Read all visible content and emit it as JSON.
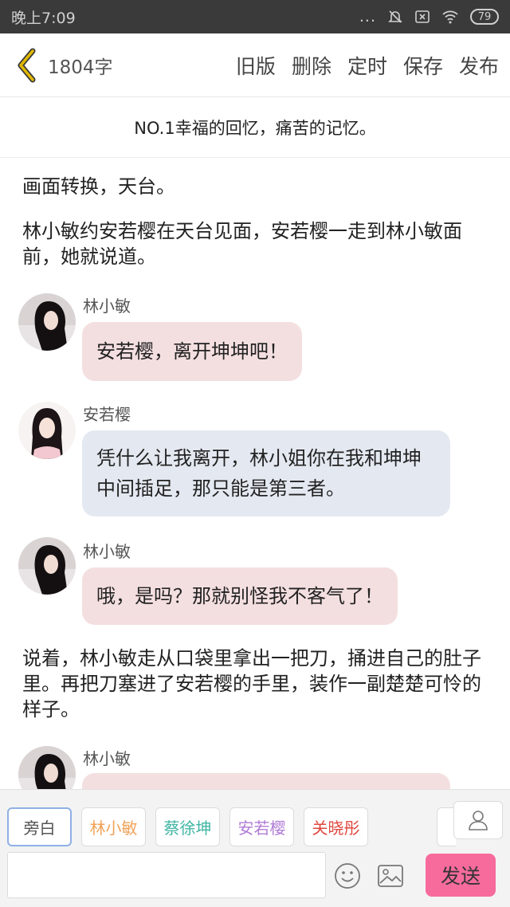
{
  "status": {
    "time": "晚上7:09",
    "dots": "...",
    "battery": "79"
  },
  "header": {
    "word_count": "1804字",
    "actions": [
      "旧版",
      "删除",
      "定时",
      "保存",
      "发布"
    ]
  },
  "chapter": {
    "title": "NO.1幸福的回忆，痛苦的记忆。"
  },
  "story": {
    "narration": [
      "画面转换，天台。",
      "林小敏约安若樱在天台见面，安若樱一走到林小敏面前，她就说道。",
      "说着，林小敏走从口袋里拿出一把刀，捅进自己的肚子里。再把刀塞进了安若樱的手里，装作一副楚楚可怜的样子。"
    ],
    "messages": [
      {
        "speaker": "林小敏",
        "text": "安若樱，离开坤坤吧！"
      },
      {
        "speaker": "安若樱",
        "text": "凭什么让我离开，林小姐你在我和坤坤中间插足，那只能是第三者。"
      },
      {
        "speaker": "林小敏",
        "text": "哦，是吗？那就别怪我不客气了！"
      },
      {
        "speaker": "林小敏",
        "text": ""
      }
    ]
  },
  "roles": [
    {
      "label": "旁白",
      "color": "#555555"
    },
    {
      "label": "林小敏",
      "color": "#f0a35a"
    },
    {
      "label": "蔡徐坤",
      "color": "#3fb5a3"
    },
    {
      "label": "安若樱",
      "color": "#b07bd6"
    },
    {
      "label": "关晓彤",
      "color": "#e0473f"
    }
  ],
  "composer": {
    "placeholder": "",
    "send_label": "发送"
  },
  "colors": {
    "bubble_pink": "#f4dfe0",
    "bubble_blue": "#e4e9f1",
    "send": "#f76b9c",
    "back_arrow": "#e0b800"
  }
}
